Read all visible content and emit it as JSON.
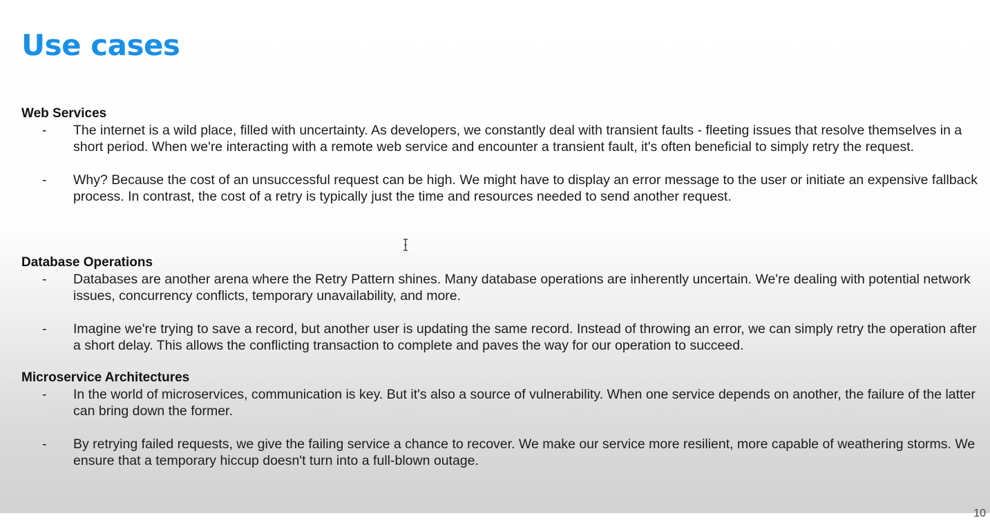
{
  "title": "Use cases",
  "sections": [
    {
      "heading": "Web Services",
      "bullets": [
        {
          "dash": "-",
          "text": "The internet is a wild place, filled with uncertainty. As developers, we constantly deal with transient faults - fleeting issues that resolve themselves in a short period. When we're interacting with a remote web service and encounter a transient fault, it's often beneficial to simply retry the request."
        },
        {
          "dash": "-",
          "text": "Why? Because the cost of an unsuccessful request can be high. We might have to display an error message to the user or initiate an expensive fallback process. In contrast, the cost of a retry is typically just the time and resources needed to send another request."
        }
      ]
    },
    {
      "heading": "Database Operations",
      "bullets": [
        {
          "dash": "-",
          "text": "Databases are another arena where the Retry Pattern shines. Many database operations are inherently uncertain. We're dealing with potential network issues, concurrency conflicts, temporary unavailability, and more."
        },
        {
          "dash": "-",
          "text": "Imagine we're trying to save a record, but another user is updating the same record. Instead of throwing an error, we can simply retry the operation after a short delay. This allows the conflicting transaction to complete and paves the way for our operation to succeed."
        }
      ]
    },
    {
      "heading": "Microservice Architectures",
      "bullets": [
        {
          "dash": "-",
          "text": "In the world of microservices, communication is key. But it's also a source of vulnerability. When one service depends on another, the failure of the latter can bring down the former."
        },
        {
          "dash": "-",
          "text": "By retrying failed requests, we give the failing service a chance to recover. We make our service more resilient, more capable of weathering storms. We ensure that a temporary hiccup doesn't turn into a full-blown outage."
        }
      ]
    }
  ],
  "page_number": "10",
  "colors": {
    "title": "#1a8fe6",
    "text": "#1c1c1c"
  },
  "icons": {
    "cursor": "text-cursor-icon"
  }
}
